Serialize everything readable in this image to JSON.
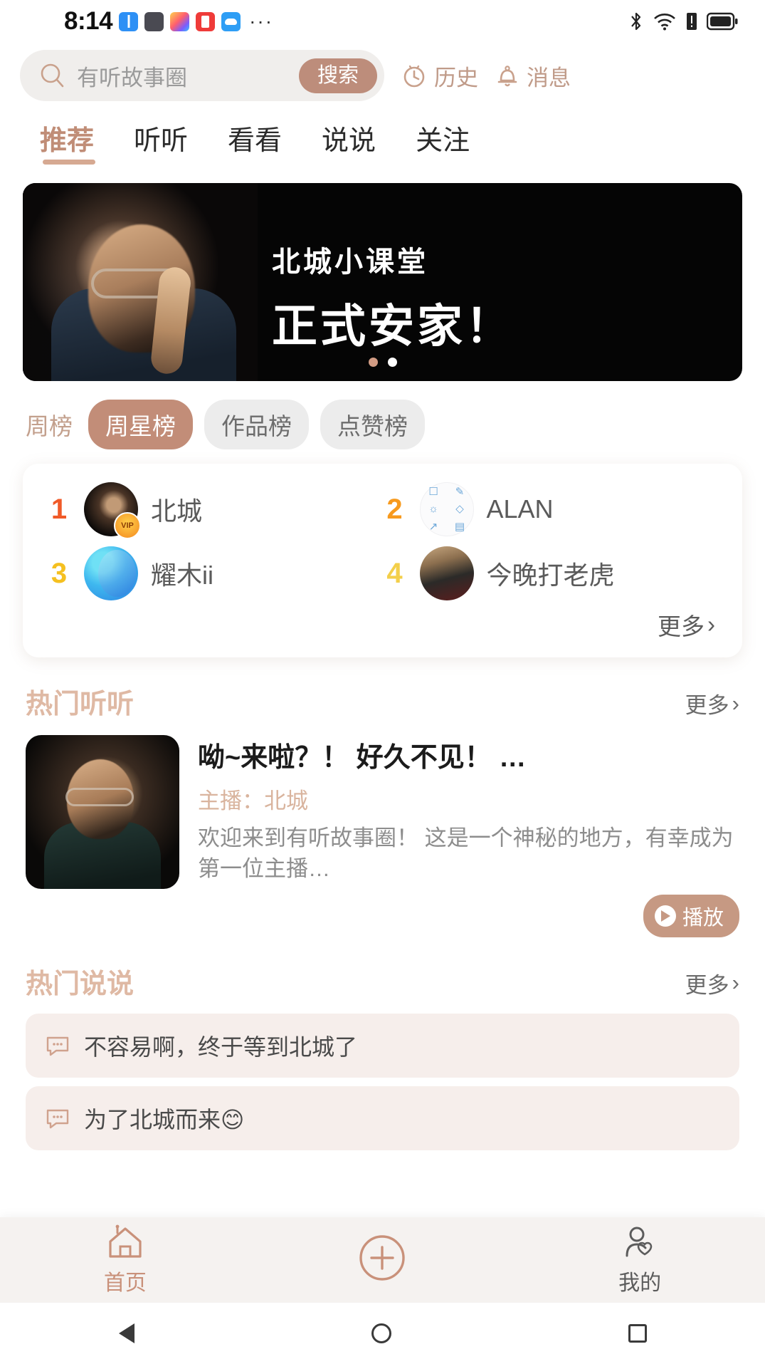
{
  "status_bar": {
    "time": "8:14",
    "overflow_dots": "···",
    "left_icons": [
      "battery-app-icon",
      "dark-app-icon",
      "rainbow-app-icon",
      "red-app-icon",
      "cloud-app-icon"
    ],
    "right_icons": [
      "bluetooth-icon",
      "wifi-icon",
      "sim-alert-icon",
      "battery-icon"
    ]
  },
  "header": {
    "search_placeholder": "有听故事圈",
    "search_button": "搜索",
    "history_label": "历史",
    "message_label": "消息",
    "accent_color": "#bd8d7b"
  },
  "tabs": [
    {
      "label": "推荐",
      "active": true
    },
    {
      "label": "听听",
      "active": false
    },
    {
      "label": "看看",
      "active": false
    },
    {
      "label": "说说",
      "active": false
    },
    {
      "label": "关注",
      "active": false
    }
  ],
  "banner": {
    "subtitle": "北城小课堂",
    "title": "正式安家！",
    "dots_count": 2,
    "active_dot": 1
  },
  "rank_chips": [
    {
      "label": "周榜",
      "style": "plain"
    },
    {
      "label": "周星榜",
      "style": "on"
    },
    {
      "label": "作品榜",
      "style": "off"
    },
    {
      "label": "点赞榜",
      "style": "off"
    }
  ],
  "rank_list": {
    "items": [
      {
        "rank": "1",
        "name": "北城",
        "badge": "VIP"
      },
      {
        "rank": "2",
        "name": "ALAN",
        "badge": ""
      },
      {
        "rank": "3",
        "name": "耀木ii",
        "badge": ""
      },
      {
        "rank": "4",
        "name": "今晚打老虎",
        "badge": ""
      }
    ],
    "more_label": "更多",
    "more_chevron": "›"
  },
  "hot_listen": {
    "section_title": "热门听听",
    "more_label": "更多",
    "more_chevron": "›",
    "card": {
      "title": "呦~来啦？！ 好久不见！ …",
      "host_label": "主播：",
      "host_name": "北城",
      "description": "欢迎来到有听故事圈！ 这是一个神秘的地方，有幸成为第一位主播…",
      "play_label": "播放"
    }
  },
  "hot_talk": {
    "section_title": "热门说说",
    "more_label": "更多",
    "more_chevron": "›",
    "comments": [
      {
        "text": "不容易啊，终于等到北城了"
      },
      {
        "text": "为了北城而来😊"
      }
    ]
  },
  "bottom_nav": [
    {
      "label": "首页",
      "icon": "home-icon",
      "active": true
    },
    {
      "label": "",
      "icon": "plus-icon",
      "active": false
    },
    {
      "label": "我的",
      "icon": "profile-icon",
      "active": false
    }
  ],
  "android_nav": [
    "back-icon",
    "home-circle-icon",
    "recents-icon"
  ]
}
